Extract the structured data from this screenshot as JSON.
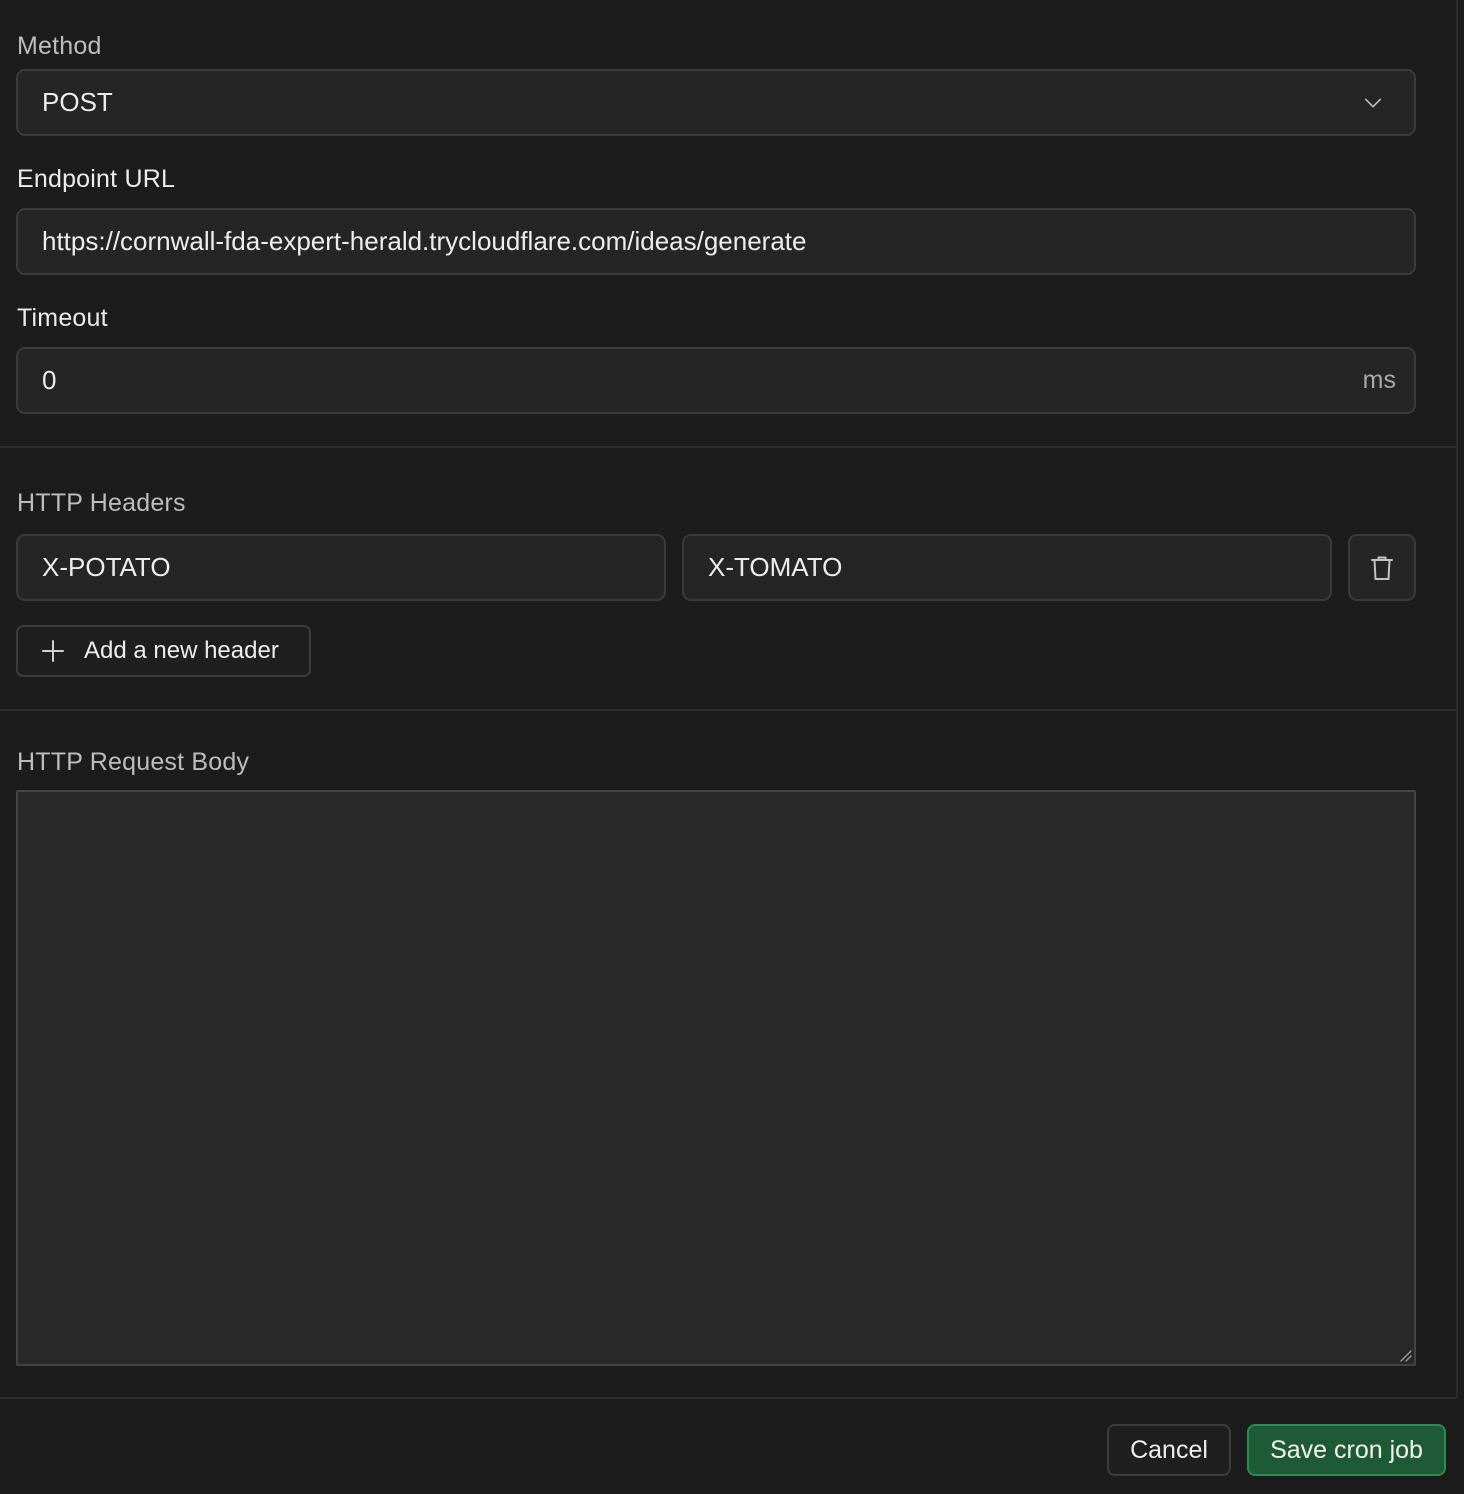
{
  "method": {
    "label": "Method",
    "value": "POST"
  },
  "endpoint": {
    "label": "Endpoint URL",
    "value": "https://cornwall-fda-expert-herald.trycloudflare.com/ideas/generate"
  },
  "timeout": {
    "label": "Timeout",
    "value": "0",
    "unit": "ms"
  },
  "headers": {
    "label": "HTTP Headers",
    "items": [
      {
        "key": "X-POTATO",
        "value": "X-TOMATO"
      }
    ],
    "add_label": "Add a new header"
  },
  "request_body": {
    "label": "HTTP Request Body",
    "value": ""
  },
  "footer": {
    "cancel_label": "Cancel",
    "save_label": "Save cron job"
  },
  "colors": {
    "background": "#1c1c1c",
    "input_bg": "#252525",
    "save_button": "#1f5a36"
  }
}
